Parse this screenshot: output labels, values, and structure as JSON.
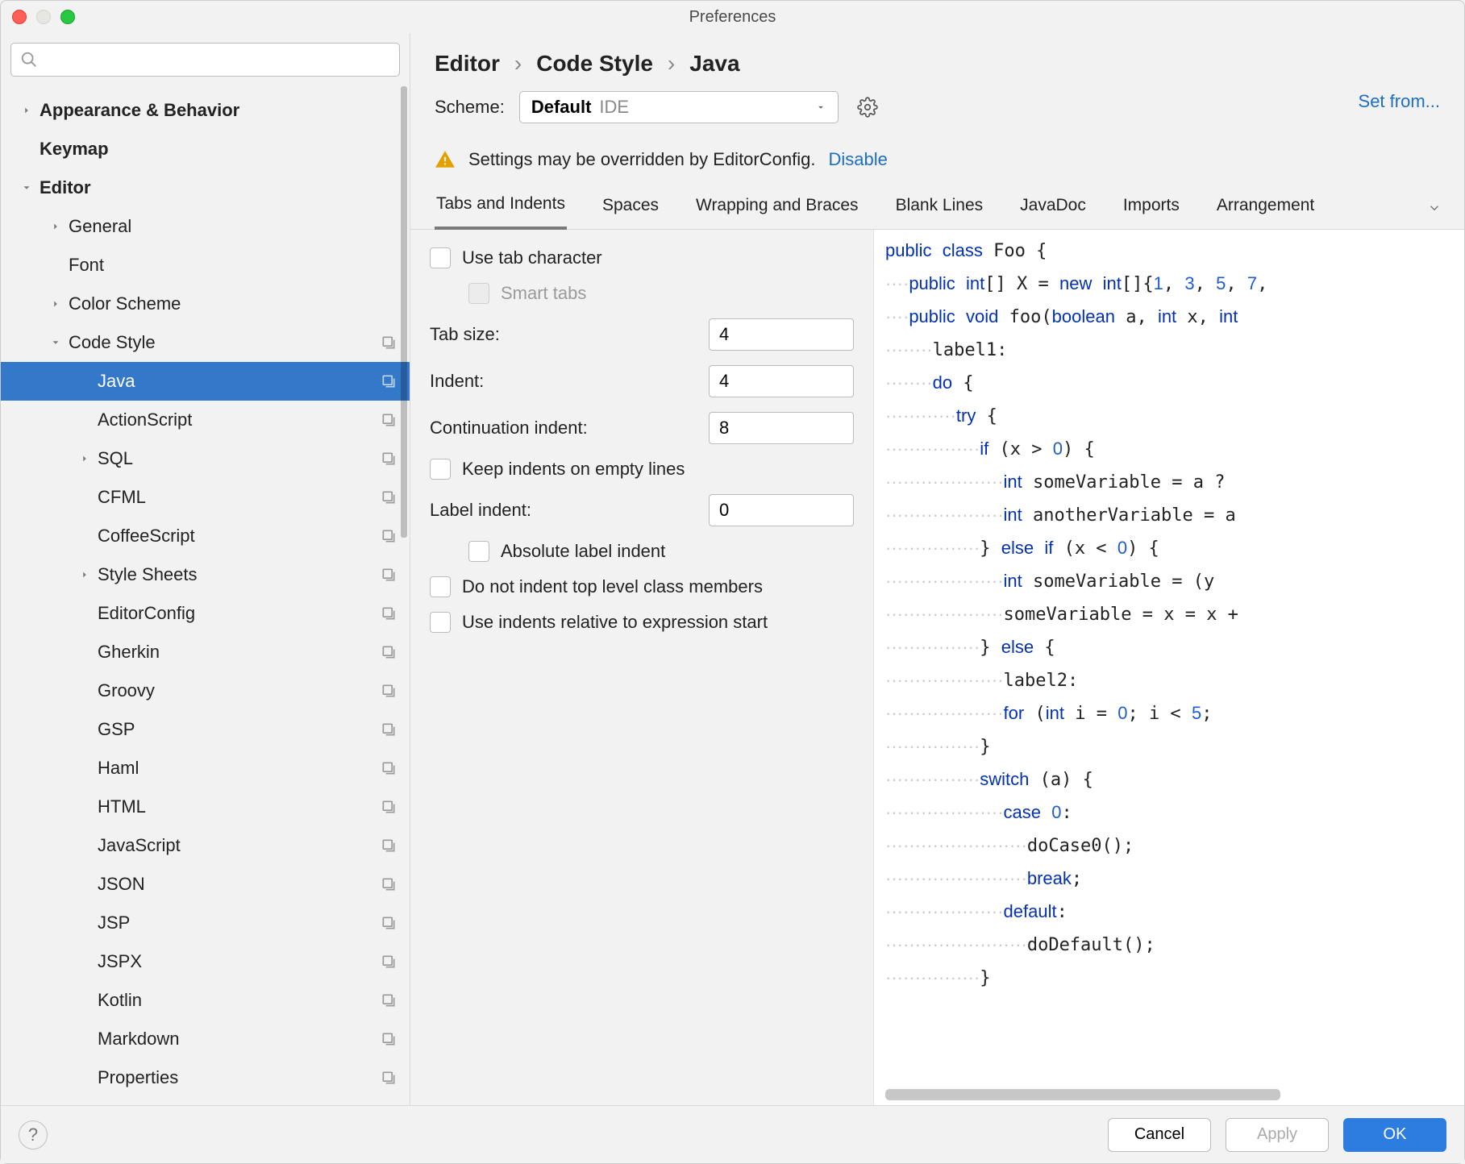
{
  "window": {
    "title": "Preferences"
  },
  "sidebar": {
    "search_placeholder": "",
    "items": [
      {
        "label": "Appearance & Behavior",
        "indent": 0,
        "arrow": "right",
        "bold": true
      },
      {
        "label": "Keymap",
        "indent": 0,
        "arrow": "none",
        "bold": true
      },
      {
        "label": "Editor",
        "indent": 0,
        "arrow": "down",
        "bold": true
      },
      {
        "label": "General",
        "indent": 1,
        "arrow": "right"
      },
      {
        "label": "Font",
        "indent": 1,
        "arrow": "none"
      },
      {
        "label": "Color Scheme",
        "indent": 1,
        "arrow": "right"
      },
      {
        "label": "Code Style",
        "indent": 1,
        "arrow": "down",
        "badge": true
      },
      {
        "label": "Java",
        "indent": 2,
        "arrow": "none",
        "badge": true,
        "selected": true
      },
      {
        "label": "ActionScript",
        "indent": 2,
        "arrow": "none",
        "badge": true
      },
      {
        "label": "SQL",
        "indent": 2,
        "arrow": "right",
        "badge": true
      },
      {
        "label": "CFML",
        "indent": 2,
        "arrow": "none",
        "badge": true
      },
      {
        "label": "CoffeeScript",
        "indent": 2,
        "arrow": "none",
        "badge": true
      },
      {
        "label": "Style Sheets",
        "indent": 2,
        "arrow": "right",
        "badge": true
      },
      {
        "label": "EditorConfig",
        "indent": 2,
        "arrow": "none",
        "badge": true
      },
      {
        "label": "Gherkin",
        "indent": 2,
        "arrow": "none",
        "badge": true
      },
      {
        "label": "Groovy",
        "indent": 2,
        "arrow": "none",
        "badge": true
      },
      {
        "label": "GSP",
        "indent": 2,
        "arrow": "none",
        "badge": true
      },
      {
        "label": "Haml",
        "indent": 2,
        "arrow": "none",
        "badge": true
      },
      {
        "label": "HTML",
        "indent": 2,
        "arrow": "none",
        "badge": true
      },
      {
        "label": "JavaScript",
        "indent": 2,
        "arrow": "none",
        "badge": true
      },
      {
        "label": "JSON",
        "indent": 2,
        "arrow": "none",
        "badge": true
      },
      {
        "label": "JSP",
        "indent": 2,
        "arrow": "none",
        "badge": true
      },
      {
        "label": "JSPX",
        "indent": 2,
        "arrow": "none",
        "badge": true
      },
      {
        "label": "Kotlin",
        "indent": 2,
        "arrow": "none",
        "badge": true
      },
      {
        "label": "Markdown",
        "indent": 2,
        "arrow": "none",
        "badge": true
      },
      {
        "label": "Properties",
        "indent": 2,
        "arrow": "none",
        "badge": true
      }
    ]
  },
  "breadcrumb": {
    "p0": "Editor",
    "p1": "Code Style",
    "p2": "Java"
  },
  "scheme": {
    "label": "Scheme:",
    "value": "Default",
    "scope": "IDE",
    "setfrom": "Set from..."
  },
  "info": {
    "text": "Settings may be overridden by EditorConfig.",
    "disable": "Disable"
  },
  "tabs": [
    "Tabs and Indents",
    "Spaces",
    "Wrapping and Braces",
    "Blank Lines",
    "JavaDoc",
    "Imports",
    "Arrangement"
  ],
  "form": {
    "use_tab_char": "Use tab character",
    "smart_tabs": "Smart tabs",
    "tab_size_label": "Tab size:",
    "tab_size": "4",
    "indent_label": "Indent:",
    "indent": "4",
    "cont_indent_label": "Continuation indent:",
    "cont_indent": "8",
    "keep_empty": "Keep indents on empty lines",
    "label_indent_label": "Label indent:",
    "label_indent": "0",
    "absolute_label": "Absolute label indent",
    "no_top_level": "Do not indent top level class members",
    "relative_expr": "Use indents relative to expression start"
  },
  "footer": {
    "cancel": "Cancel",
    "apply": "Apply",
    "ok": "OK"
  },
  "code": [
    [
      [
        "kw",
        "public"
      ],
      [
        "p",
        " "
      ],
      [
        "kw",
        "class"
      ],
      [
        "p",
        " Foo {"
      ]
    ],
    [
      [
        "ws",
        4
      ],
      [
        "kw",
        "public"
      ],
      [
        "p",
        " "
      ],
      [
        "kw",
        "int"
      ],
      [
        "p",
        "[] X = "
      ],
      [
        "kw",
        "new"
      ],
      [
        "p",
        " "
      ],
      [
        "kw",
        "int"
      ],
      [
        "p",
        "[]{"
      ],
      [
        "num",
        "1"
      ],
      [
        "p",
        ", "
      ],
      [
        "num",
        "3"
      ],
      [
        "p",
        ", "
      ],
      [
        "num",
        "5"
      ],
      [
        "p",
        ", "
      ],
      [
        "num",
        "7"
      ],
      [
        "p",
        ","
      ]
    ],
    [
      [
        "p",
        ""
      ]
    ],
    [
      [
        "ws",
        4
      ],
      [
        "kw",
        "public"
      ],
      [
        "p",
        " "
      ],
      [
        "kw",
        "void"
      ],
      [
        "p",
        " foo("
      ],
      [
        "kw",
        "boolean"
      ],
      [
        "p",
        " a, "
      ],
      [
        "kw",
        "int"
      ],
      [
        "p",
        " x, "
      ],
      [
        "kw",
        "int"
      ],
      [
        "p",
        " "
      ]
    ],
    [
      [
        "ws",
        8
      ],
      [
        "p",
        "label1:"
      ]
    ],
    [
      [
        "ws",
        8
      ],
      [
        "kw",
        "do"
      ],
      [
        "p",
        " {"
      ]
    ],
    [
      [
        "ws",
        12
      ],
      [
        "kw",
        "try"
      ],
      [
        "p",
        " {"
      ]
    ],
    [
      [
        "ws",
        16
      ],
      [
        "kw",
        "if"
      ],
      [
        "p",
        " (x > "
      ],
      [
        "num",
        "0"
      ],
      [
        "p",
        ") {"
      ]
    ],
    [
      [
        "ws",
        20
      ],
      [
        "kw",
        "int"
      ],
      [
        "p",
        " someVariable = a ?"
      ]
    ],
    [
      [
        "ws",
        20
      ],
      [
        "kw",
        "int"
      ],
      [
        "p",
        " anotherVariable = a"
      ]
    ],
    [
      [
        "ws",
        16
      ],
      [
        "p",
        "} "
      ],
      [
        "kw",
        "else"
      ],
      [
        "p",
        " "
      ],
      [
        "kw",
        "if"
      ],
      [
        "p",
        " (x < "
      ],
      [
        "num",
        "0"
      ],
      [
        "p",
        ") {"
      ]
    ],
    [
      [
        "ws",
        20
      ],
      [
        "kw",
        "int"
      ],
      [
        "p",
        " someVariable = (y "
      ]
    ],
    [
      [
        "ws",
        20
      ],
      [
        "p",
        "someVariable = x = x +"
      ]
    ],
    [
      [
        "ws",
        16
      ],
      [
        "p",
        "} "
      ],
      [
        "kw",
        "else"
      ],
      [
        "p",
        " {"
      ]
    ],
    [
      [
        "ws",
        20
      ],
      [
        "p",
        "label2:"
      ]
    ],
    [
      [
        "ws",
        20
      ],
      [
        "kw",
        "for"
      ],
      [
        "p",
        " ("
      ],
      [
        "kw",
        "int"
      ],
      [
        "p",
        " i = "
      ],
      [
        "num",
        "0"
      ],
      [
        "p",
        "; i < "
      ],
      [
        "num",
        "5"
      ],
      [
        "p",
        ";"
      ]
    ],
    [
      [
        "ws",
        16
      ],
      [
        "p",
        "}"
      ]
    ],
    [
      [
        "ws",
        16
      ],
      [
        "kw",
        "switch"
      ],
      [
        "p",
        " (a) {"
      ]
    ],
    [
      [
        "ws",
        20
      ],
      [
        "kw",
        "case"
      ],
      [
        "p",
        " "
      ],
      [
        "num",
        "0"
      ],
      [
        "p",
        ":"
      ]
    ],
    [
      [
        "ws",
        24
      ],
      [
        "p",
        "doCase0();"
      ]
    ],
    [
      [
        "ws",
        24
      ],
      [
        "kw",
        "break"
      ],
      [
        "p",
        ";"
      ]
    ],
    [
      [
        "ws",
        20
      ],
      [
        "kw",
        "default"
      ],
      [
        "p",
        ":"
      ]
    ],
    [
      [
        "ws",
        24
      ],
      [
        "p",
        "doDefault();"
      ]
    ],
    [
      [
        "ws",
        16
      ],
      [
        "p",
        "}"
      ]
    ]
  ]
}
